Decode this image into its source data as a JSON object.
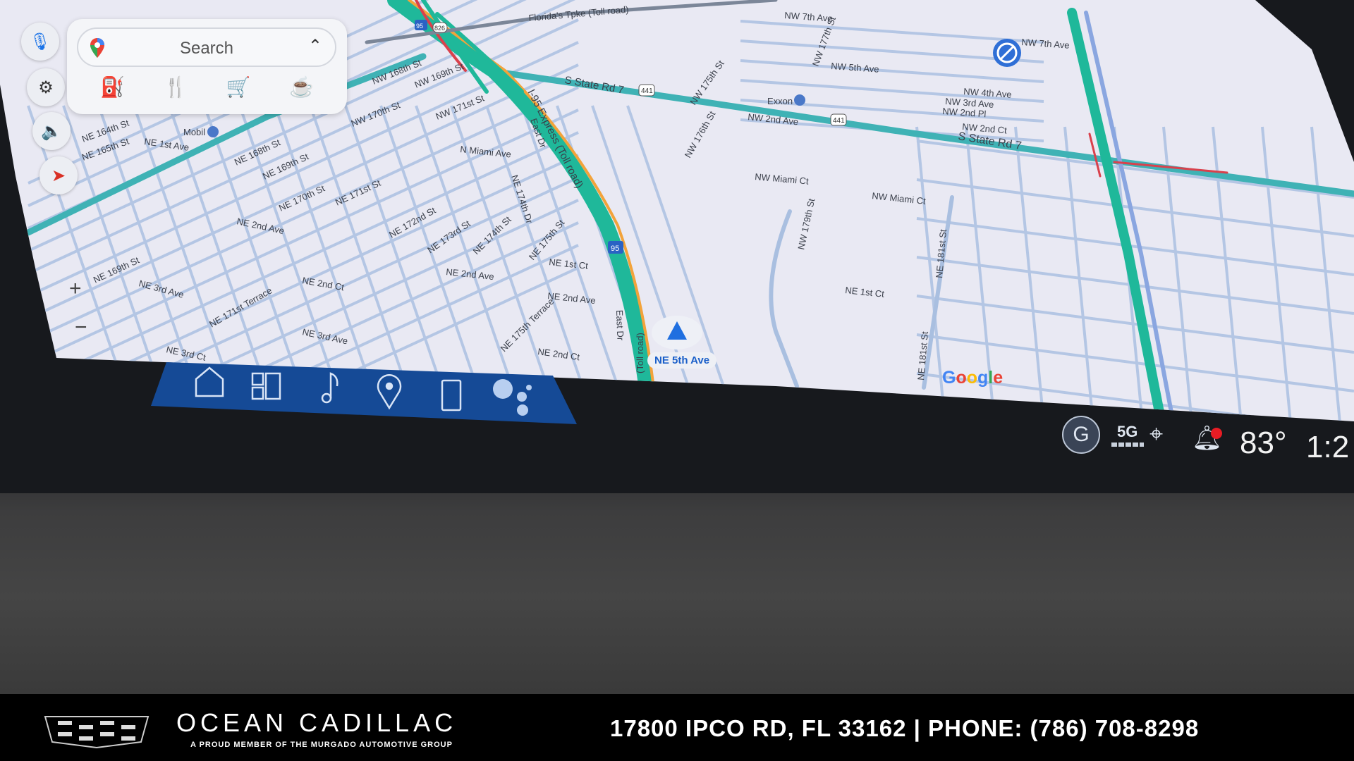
{
  "search": {
    "placeholder": "Search",
    "categories": [
      "gas-station",
      "restaurants",
      "grocery",
      "coffee"
    ]
  },
  "left_controls": [
    "microphone",
    "settings",
    "volume",
    "compass"
  ],
  "zoom": {
    "in": "+",
    "out": "−"
  },
  "map": {
    "labels": [
      "S State Rd 7",
      "S State Rd 7",
      "I-95 Express (Toll road)",
      "(Toll road)",
      "NW Miami Ct",
      "NW Miami Ct",
      "NE 1st Ct",
      "NE 1st Ct",
      "NE 2nd Ave",
      "NE 2nd Ave",
      "N Miami Ave",
      "NW 2nd Ave",
      "Exxon",
      "Mobil",
      "NE 164th St",
      "NE 165th St",
      "NE 168th St",
      "NE 169th St",
      "NE 170th St",
      "NE 171st St",
      "NE 172nd St",
      "NE 173rd St",
      "NE 174th St",
      "NE 175th St",
      "NE 169th St",
      "NE 3rd Ave",
      "NE 2nd Ave",
      "NE 2nd Ct",
      "NE 2nd Ct",
      "NE 3rd Ave",
      "NE 3rd Ct",
      "NW 179th St",
      "NE 181st St",
      "NE 181st St",
      "NW 7th Ave",
      "NW 7th Ave",
      "NW 5th Ave",
      "NW 4th Ave",
      "NW 3rd Ave",
      "NW 2nd Pl",
      "NW 2nd Ct",
      "Florida's Tpke (Toll road)",
      "East Dr",
      "East Dr",
      "NE 174th Dr",
      "NW 175th St",
      "NW 176th St",
      "NW 177th St",
      "NW 168th St",
      "NW 169th St",
      "NW 170th St",
      "NW 171st St",
      "NE 1st Ave",
      "NE 175th Terrace",
      "NE 171st Terrace"
    ],
    "shields": [
      "95",
      "95",
      "441",
      "441",
      "826"
    ],
    "current_street": "NE 5th Ave",
    "attribution": "Google",
    "colors": {
      "traffic_ok": "#1fb89a",
      "traffic_slow": "#f2a33a",
      "traffic_heavy": "#d9414c",
      "road": "#a9bfe0",
      "background": "#e9e9f3"
    }
  },
  "dock": [
    "home",
    "apps",
    "media",
    "navigation",
    "phone",
    "assistant"
  ],
  "status": {
    "account_initial": "G",
    "network": "5G",
    "temperature": "83°",
    "time": "1:2",
    "notification_dot_color": "#e81c24"
  },
  "banner": {
    "brand": "OCEAN CADILLAC",
    "tagline": "A PROUD MEMBER OF THE  MURGADO AUTOMOTIVE GROUP",
    "address": "17800 IPCO RD, FL 33162  |  PHONE: (786) 708-8298"
  }
}
